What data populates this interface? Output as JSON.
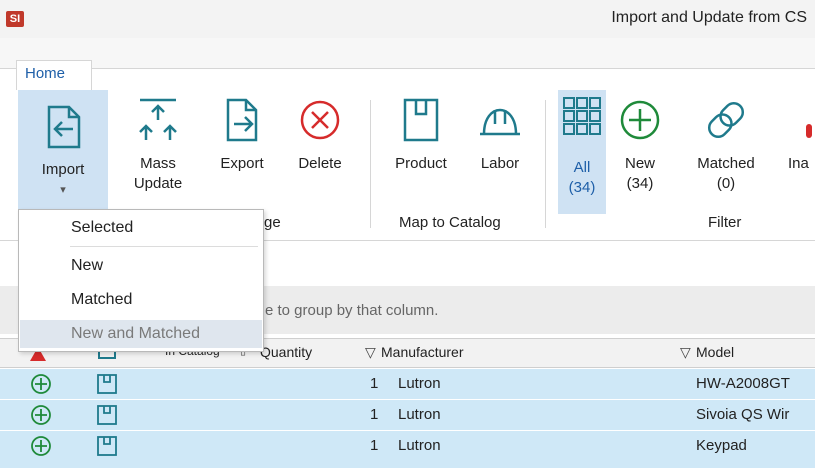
{
  "window": {
    "app_icon": "SI",
    "title": "Import and Update from CS"
  },
  "tabs": [
    {
      "label": "Home"
    }
  ],
  "ribbon": {
    "import": {
      "label": "Import",
      "arrow": "▾"
    },
    "mass_update": {
      "label": "Mass\nUpdate"
    },
    "export": {
      "label": "Export"
    },
    "delete": {
      "label": "Delete"
    },
    "group1_label_fragment": "ge",
    "product": {
      "label": "Product"
    },
    "labor": {
      "label": "Labor"
    },
    "map_to_catalog": "Map to Catalog",
    "filter_all": {
      "label": "All",
      "count": "(34)"
    },
    "filter_new": {
      "label": "New",
      "count": "(34)"
    },
    "filter_matched": {
      "label": "Matched",
      "count": "(0)"
    },
    "filter_partial": "Ina",
    "filter_label": "Filter"
  },
  "import_menu": {
    "items": [
      "Selected",
      "New",
      "Matched",
      "New and Matched"
    ]
  },
  "grid": {
    "group_hint": "e to group by that column.",
    "columns": {
      "in_catalog": "In Catalog",
      "quantity": "Quantity",
      "manufacturer": "Manufacturer",
      "model": "Model"
    },
    "rows": [
      {
        "quantity": "1",
        "manufacturer": "Lutron",
        "model": "HW-A2008GT"
      },
      {
        "quantity": "1",
        "manufacturer": "Lutron",
        "model": "Sivoia QS Wir"
      },
      {
        "quantity": "1",
        "manufacturer": "Lutron",
        "model": "Keypad"
      }
    ]
  },
  "colors": {
    "accent": "#1e5fa8",
    "import_highlight": "#cfe2f3",
    "row_highlight": "#cfe8f7",
    "add_icon": "#1f8a3a",
    "delete_icon": "#d62b2b"
  }
}
